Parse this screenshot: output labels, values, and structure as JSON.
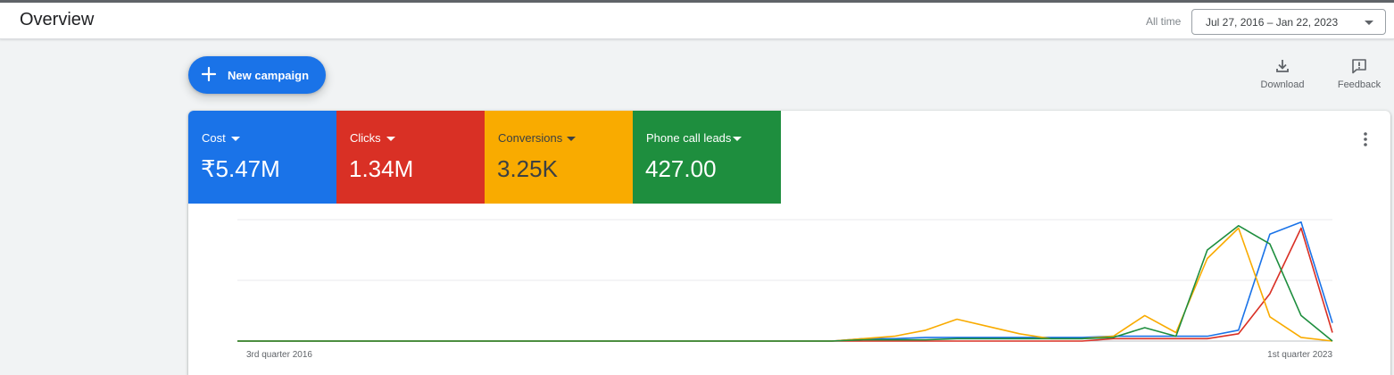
{
  "header": {
    "title": "Overview",
    "range_label": "All time",
    "date_range": "Jul 27, 2016 – Jan 22, 2023"
  },
  "toolbar": {
    "new_campaign_label": "New campaign",
    "download_label": "Download",
    "feedback_label": "Feedback"
  },
  "metrics": [
    {
      "label": "Cost",
      "value": "₹5.47M",
      "color": "#1a73e8",
      "text_color": "#ffffff"
    },
    {
      "label": "Clicks",
      "value": "1.34M",
      "color": "#d93025",
      "text_color": "#ffffff"
    },
    {
      "label": "Conversions",
      "value": "3.25K",
      "color": "#f9ab00",
      "text_color": "#3c4043"
    },
    {
      "label": "Phone call leads",
      "value": "427.00",
      "color": "#1e8e3e",
      "text_color": "#ffffff"
    }
  ],
  "chart_data": {
    "type": "line",
    "x_tick_labels": [
      "3rd quarter 2016",
      "1st quarter 2023"
    ],
    "grid": true,
    "series": [
      {
        "name": "Cost",
        "color": "#1a73e8",
        "values": [
          0,
          0,
          0,
          0,
          0,
          0,
          0,
          0,
          0,
          0,
          0,
          0,
          0,
          0,
          0,
          0,
          0,
          0,
          0,
          0,
          0.02,
          0.02,
          0.03,
          0.03,
          0.03,
          0.03,
          0.03,
          0.03,
          0.04,
          0.04,
          0.04,
          0.04,
          0.09,
          0.88,
          0.98,
          0.15
        ]
      },
      {
        "name": "Clicks",
        "color": "#d93025",
        "values": [
          0,
          0,
          0,
          0,
          0,
          0,
          0,
          0,
          0,
          0,
          0,
          0,
          0,
          0,
          0,
          0,
          0,
          0,
          0,
          0,
          0,
          0,
          0,
          0,
          0,
          0,
          0,
          0,
          0.02,
          0.02,
          0.02,
          0.02,
          0.06,
          0.39,
          0.93,
          0.07
        ]
      },
      {
        "name": "Conversions",
        "color": "#f9ab00",
        "values": [
          0,
          0,
          0,
          0,
          0,
          0,
          0,
          0,
          0,
          0,
          0,
          0,
          0,
          0,
          0,
          0,
          0,
          0,
          0,
          0,
          0.02,
          0.04,
          0.09,
          0.18,
          0.12,
          0.06,
          0.02,
          0.02,
          0.04,
          0.21,
          0.07,
          0.68,
          0.93,
          0.2,
          0.03,
          0
        ]
      },
      {
        "name": "Phone call leads",
        "color": "#1e8e3e",
        "values": [
          0,
          0,
          0,
          0,
          0,
          0,
          0,
          0,
          0,
          0,
          0,
          0,
          0,
          0,
          0,
          0,
          0,
          0,
          0,
          0,
          0.01,
          0.01,
          0.01,
          0.02,
          0.02,
          0.02,
          0.02,
          0.02,
          0.03,
          0.11,
          0.04,
          0.75,
          0.95,
          0.8,
          0.21,
          0
        ]
      }
    ],
    "ylim": [
      0,
      1
    ]
  }
}
